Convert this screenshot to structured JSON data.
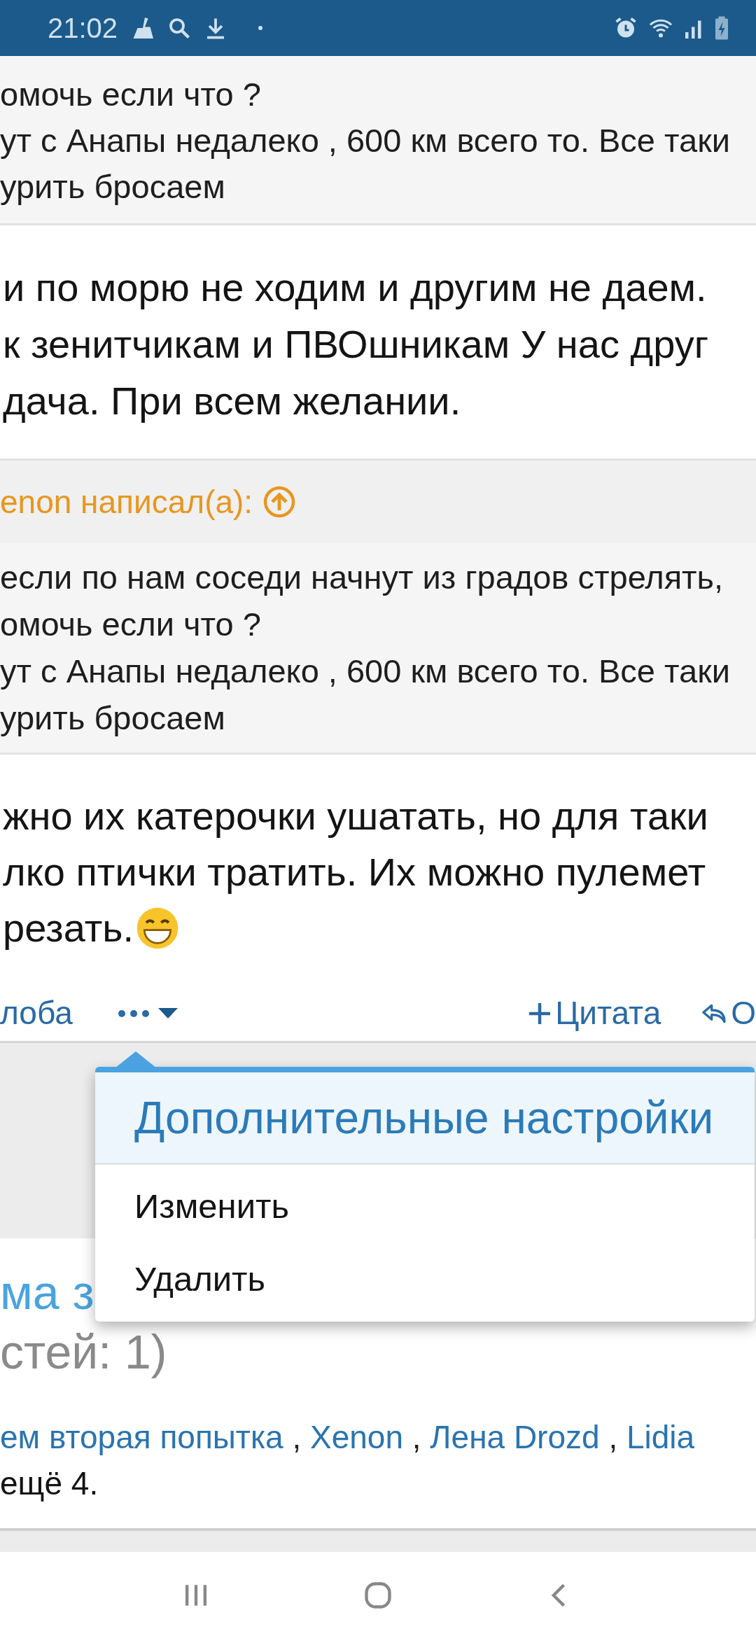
{
  "status_bar": {
    "time": "21:02"
  },
  "quote_top": {
    "lines": [
      "омочь если что ?",
      "ут с Анапы недалеко , 600 км всего то. Все таки",
      "урить бросаем"
    ]
  },
  "post_1": {
    "lines": [
      "и по морю не ходим и другим не даем.",
      "к зенитчикам и ПВОшникам У нас друг",
      "дача. При всем желании."
    ]
  },
  "quote_2": {
    "author": "enon написал(а):",
    "lines": [
      "если по нам соседи начнут из градов стрелять,",
      "омочь если что ?",
      "ут с Анапы недалеко , 600 км всего то. Все таки",
      "урить бросаем"
    ]
  },
  "post_2": {
    "lines": [
      "жно их катерочки ушатать, но для таки",
      "лко птички тратить. Их можно пулемет",
      "резать."
    ]
  },
  "actions": [
    {
      "kind": "text",
      "label": "лоба"
    },
    {
      "kind": "more"
    },
    {
      "kind": "quote",
      "label": "Цитата"
    },
    {
      "kind": "reply",
      "label": "О"
    }
  ],
  "menu": {
    "title": "Дополнительные настройки",
    "items": [
      "Изменить",
      "Удалить"
    ]
  },
  "thread": {
    "title": "ма з",
    "meta": "стей: 1)",
    "users": [
      "ем вторая попытка",
      "Xenon",
      "Лена Drozd",
      "Lidia"
    ],
    "separator": ",",
    "more": "ещё 4."
  }
}
